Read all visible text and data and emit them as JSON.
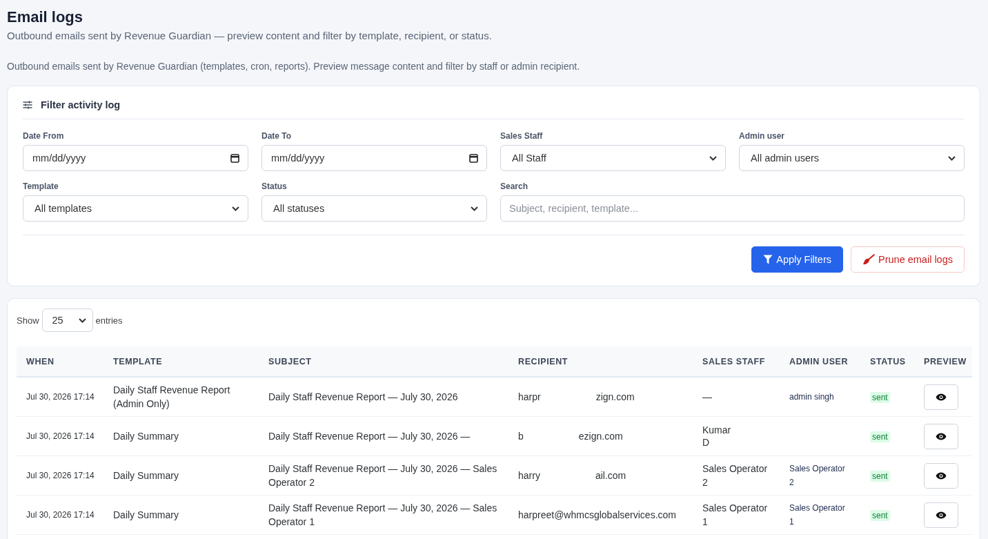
{
  "page": {
    "title": "Email logs",
    "subtitle": "Outbound emails sent by Revenue Guardian — preview content and filter by template, recipient, or status.",
    "description": "Outbound emails sent by Revenue Guardian (templates, cron, reports). Preview message content and filter by staff or admin recipient."
  },
  "filter_card": {
    "title": "Filter activity log",
    "fields": [
      {
        "label": "Date From",
        "kind": "date",
        "placeholder": "mm/dd/yyyy"
      },
      {
        "label": "Date To",
        "kind": "date",
        "placeholder": "mm/dd/yyyy"
      },
      {
        "label": "Sales Staff",
        "kind": "select",
        "value": "All Staff"
      },
      {
        "label": "Admin user",
        "kind": "select",
        "value": "All admin users"
      },
      {
        "label": "Template",
        "kind": "select",
        "value": "All templates"
      },
      {
        "label": "Status",
        "kind": "select",
        "value": "All statuses"
      },
      {
        "label": "Search",
        "kind": "search",
        "placeholder": "Subject, recipient, template..."
      }
    ],
    "buttons": [
      {
        "label": "Apply Filters",
        "kind": "primary"
      },
      {
        "label": "Prune email logs",
        "kind": "danger"
      }
    ]
  },
  "logs_card": {
    "length_menu": {
      "label_before": "Show",
      "value": "25",
      "label_after": "entries"
    },
    "table": {
      "columns": [
        "WHEN",
        "TEMPLATE",
        "SUBJECT",
        "RECIPIENT",
        "SALES STAFF",
        "ADMIN USER",
        "STATUS",
        "PREVIEW"
      ],
      "rows": [
        {
          "when": "Jul 30, 2026 17:14",
          "template": "Daily Staff Revenue Report (Admin Only)",
          "subject": "Daily Staff Revenue Report — July 30, 2026",
          "recipient": {
            "kind": "gapped",
            "parts": [
              "harpr",
              "zign.com"
            ]
          },
          "sales_staff": "—",
          "admin_user": "admin singh",
          "status": "sent"
        },
        {
          "when": "Jul 30, 2026 17:14",
          "template": "Daily Summary",
          "subject": "Daily Staff Revenue Report — July 30, 2026 —",
          "recipient": {
            "kind": "gapped",
            "parts": [
              "b",
              "ezign.com"
            ]
          },
          "sales_staff": {
            "kind": "lines",
            "parts": [
              "Kumar",
              "D"
            ]
          },
          "status": "sent"
        },
        {
          "when": "Jul 30, 2026 17:14",
          "template": "Daily Summary",
          "subject": "Daily Staff Revenue Report — July 30, 2026 — Sales Operator 2",
          "recipient": {
            "kind": "gapped",
            "parts": [
              "harry",
              "ail.com"
            ]
          },
          "sales_staff": "Sales Operator 2",
          "admin_user": "Sales Operator 2",
          "status": "sent"
        },
        {
          "when": "Jul 30, 2026 17:14",
          "template": "Daily Summary",
          "subject": "Daily Staff Revenue Report — July 30, 2026 — Sales Operator 1",
          "recipient": "harpreet@whmcsglobalservices.com",
          "sales_staff": "Sales Operator 1",
          "admin_user": "Sales Operator 1",
          "status": "sent"
        }
      ]
    }
  }
}
